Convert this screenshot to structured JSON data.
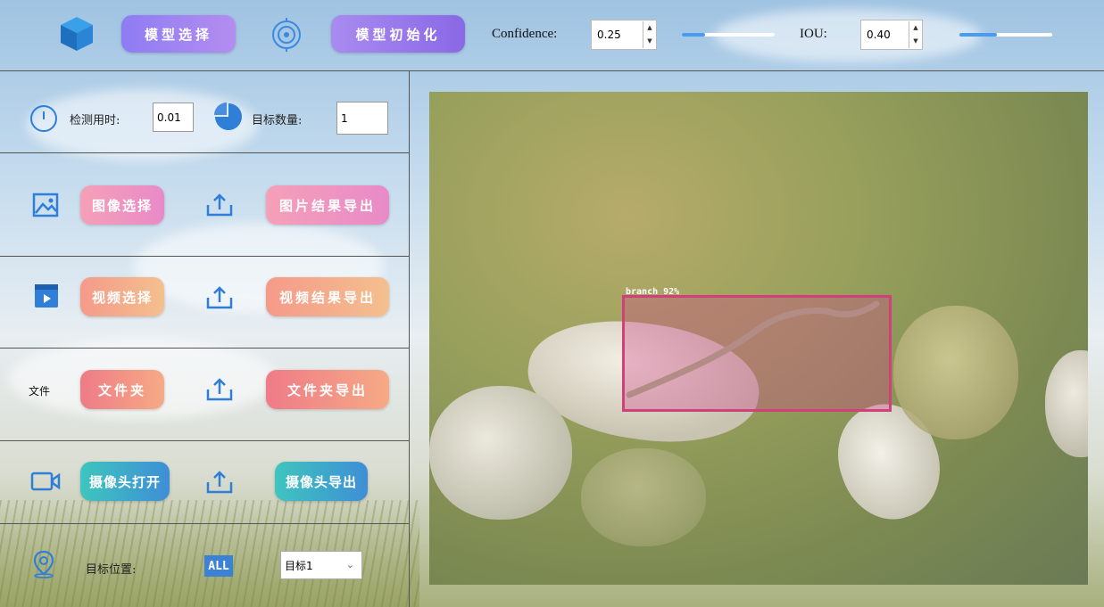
{
  "topbar": {
    "model_select_label": "模型选择",
    "model_init_label": "模型初始化",
    "confidence_label": "Confidence:",
    "confidence_value": "0.25",
    "confidence_level": 0.25,
    "iou_label": "IOU:",
    "iou_value": "0.40",
    "iou_level": 0.4
  },
  "stats": {
    "time_label": "检测用时:",
    "time_value": "0.01",
    "count_label": "目标数量:",
    "count_value": "1"
  },
  "image_row": {
    "select_label": "图像选择",
    "export_label": "图片结果导出"
  },
  "video_row": {
    "select_label": "视频选择",
    "export_label": "视频结果导出"
  },
  "folder_row": {
    "icon_text": "文件",
    "select_label": "文件夹",
    "export_label": "文件夹导出"
  },
  "camera_row": {
    "open_label": "摄像头打开",
    "export_label": "摄像头导出"
  },
  "position": {
    "label": "目标位置:",
    "all_badge": "ALL",
    "target_selected": "目标1"
  },
  "detection": {
    "label": "branch 92%"
  },
  "colors": {
    "accent": "#4a9cf0",
    "bbox": "#d0407a",
    "divider": "#555555"
  }
}
